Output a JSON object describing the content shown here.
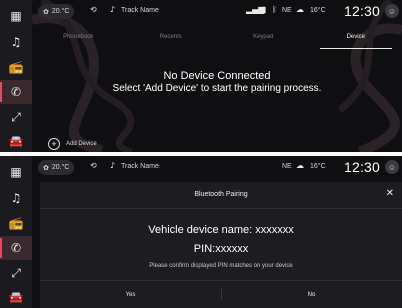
{
  "colors": {
    "background": "#0f0f11",
    "rail": "#1b1b1f",
    "accent": "#e44b5e",
    "dialog": "#1c1c21"
  },
  "nav": {
    "items": [
      {
        "icon": "apps-grid-icon",
        "glyph": "▦"
      },
      {
        "icon": "music-icon",
        "glyph": "♫"
      },
      {
        "icon": "radio-icon",
        "glyph": "📻"
      },
      {
        "icon": "phone-icon",
        "glyph": "✆"
      },
      {
        "icon": "navigation-icon",
        "glyph": "⤢"
      },
      {
        "icon": "car-icon",
        "glyph": "🚘"
      }
    ],
    "active_index": 3
  },
  "status": {
    "temp_left": "20.°C",
    "media_text": "Track Name",
    "nav_code": "NE",
    "temp_right": "16°C",
    "time": "12:30"
  },
  "tabs": [
    "Phonebook",
    "Recents",
    "Keypad",
    "Device"
  ],
  "empty": {
    "title": "No Device Connected",
    "subtitle": "Select 'Add Device' to start the pairing process."
  },
  "add_device": {
    "label": "Add Device"
  },
  "dialog": {
    "title": "Bluetooth Pairing",
    "device_name": "Vehicle device name: xxxxxxx",
    "pin": "PIN:xxxxxx",
    "message": "Please confirm displayed PIN matches on your device",
    "yes": "Yes",
    "no": "No"
  }
}
